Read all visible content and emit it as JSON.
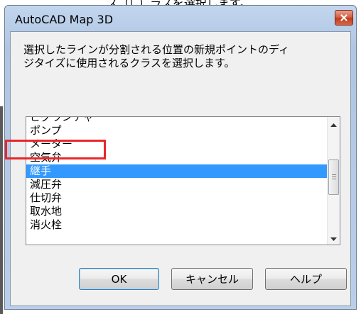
{
  "top_strip_text": "ス（「 ）ラスを選択します。",
  "window": {
    "title": "AutoCAD Map 3D",
    "close_icon": "close-icon"
  },
  "prompt": {
    "line1": "選択したラインが分割される位置の新規ポイントのディ",
    "line2": "ジタイズに使用されるクラスを選択します。"
  },
  "list": {
    "items": [
      {
        "label": "ピグランチャー",
        "selected": false
      },
      {
        "label": "ポンプ",
        "selected": false
      },
      {
        "label": "メーター",
        "selected": false
      },
      {
        "label": "空気弁",
        "selected": false
      },
      {
        "label": "継手",
        "selected": true
      },
      {
        "label": "減圧弁",
        "selected": false
      },
      {
        "label": "仕切弁",
        "selected": false
      },
      {
        "label": "取水地",
        "selected": false
      },
      {
        "label": "消火栓",
        "selected": false
      }
    ],
    "selected_color": "#3399ff"
  },
  "buttons": {
    "ok": "OK",
    "cancel": "キャンセル",
    "help": "ヘルプ"
  },
  "colors": {
    "highlight_box": "#e8272a",
    "close_button": "#c0391c"
  }
}
